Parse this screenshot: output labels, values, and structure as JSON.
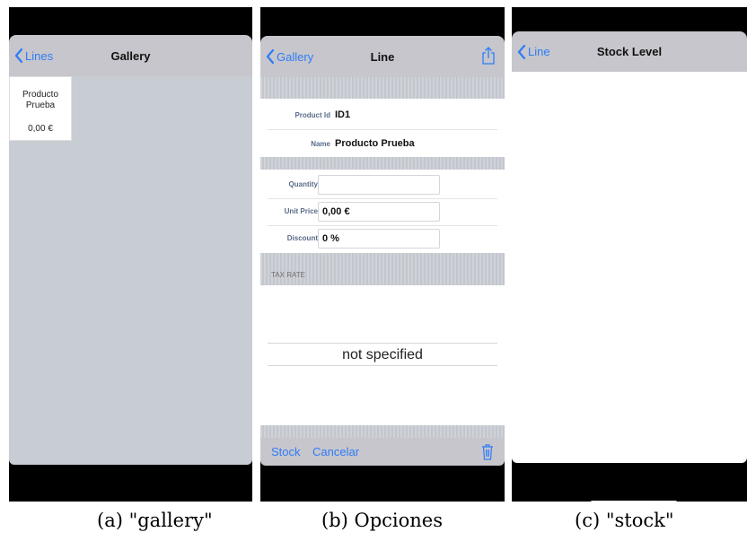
{
  "screens": [
    {
      "id": "gallery",
      "nav": {
        "back_label": "Lines",
        "title": "Gallery"
      },
      "tile": {
        "name": "Producto Prueba",
        "price": "0,00 €"
      },
      "caption": "(a) \"gallery\""
    },
    {
      "id": "line",
      "nav": {
        "back_label": "Gallery",
        "title": "Line",
        "action_icon": "share-icon"
      },
      "product": {
        "id_label": "Product Id",
        "id_value": "ID1",
        "name_label": "Name",
        "name_value": "Producto Prueba"
      },
      "fields": {
        "quantity_label": "Quantity",
        "quantity_value": "",
        "unit_price_label": "Unit Price",
        "unit_price_value": "0,00 €",
        "discount_label": "Discount",
        "discount_value": "0 %"
      },
      "tax": {
        "header": "TAX RATE",
        "selected": "not specified"
      },
      "toolbar": {
        "stock_label": "Stock",
        "cancel_label": "Cancelar",
        "delete_icon": "trash-icon"
      },
      "caption": "(b) Opciones"
    },
    {
      "id": "stock",
      "nav": {
        "back_label": "Line",
        "title": "Stock Level"
      },
      "caption": "(c) \"stock\""
    }
  ],
  "colors": {
    "accent": "#2f7cf6",
    "navbar": "#c6c6cc",
    "gallery_bg": "#c8ccd3"
  }
}
